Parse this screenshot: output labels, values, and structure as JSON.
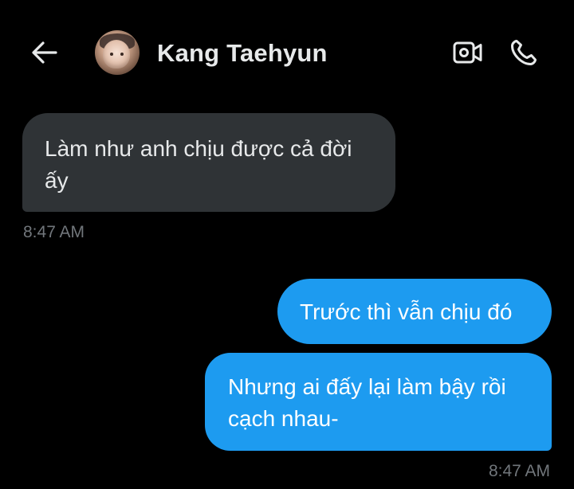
{
  "header": {
    "back_icon": "arrow-left-icon",
    "contact_name": "Kang Taehyun",
    "video_icon": "video-camera-icon",
    "call_icon": "phone-icon"
  },
  "messages": [
    {
      "direction": "incoming",
      "text": "Làm như anh chịu được cả đời ấy",
      "time": "8:47 AM"
    },
    {
      "direction": "outgoing",
      "text": "Trước thì vẫn chịu đó"
    },
    {
      "direction": "outgoing",
      "text": "Nhưng ai đấy lại làm bậy rồi cạch nhau-",
      "time": "8:47 AM"
    }
  ],
  "colors": {
    "background": "#000000",
    "incoming_bubble": "#2f3336",
    "outgoing_bubble": "#1d9bf0",
    "primary_text": "#e7e9ea",
    "secondary_text": "#71767b"
  }
}
